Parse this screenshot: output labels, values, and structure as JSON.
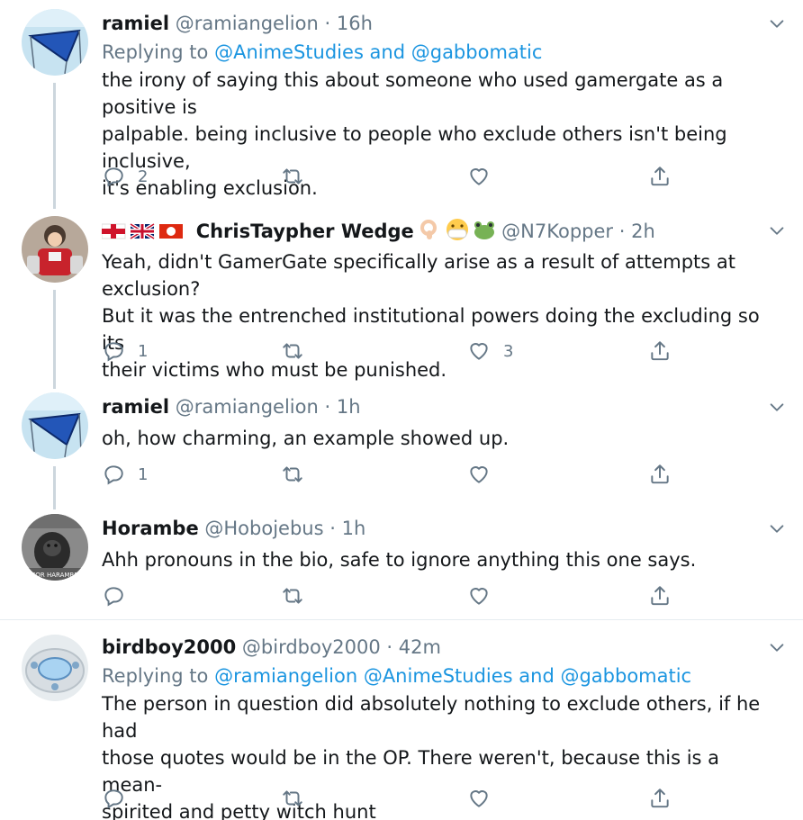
{
  "tweets": [
    {
      "name": "ramiel",
      "handle": "@ramiangelion",
      "sep": "·",
      "time": "16h",
      "replying_prefix": "Replying to",
      "replying_mentions": "@AnimeStudies and @gabbomatic",
      "lines": [
        "the irony of saying this about someone who used gamergate as a positive is",
        "palpable. being inclusive to people who exclude others isn't being inclusive,",
        "it's enabling exclusion."
      ],
      "replies": "2",
      "retweets": "",
      "likes": ""
    },
    {
      "name": "ChrisTaypher Wedge",
      "handle": "@N7Kopper",
      "sep": "·",
      "time": "2h",
      "lines": [
        "Yeah, didn't GamerGate specifically arise as a result of attempts at exclusion?",
        "But it was the entrenched institutional powers doing the excluding so its",
        "their victims who must be punished."
      ],
      "replies": "1",
      "retweets": "",
      "likes": "3"
    },
    {
      "name": "ramiel",
      "handle": "@ramiangelion",
      "sep": "·",
      "time": "1h",
      "lines": [
        "oh, how charming, an example showed up."
      ],
      "replies": "1",
      "retweets": "",
      "likes": ""
    },
    {
      "name": "Horambe",
      "handle": "@Hobojebus",
      "sep": "·",
      "time": "1h",
      "lines": [
        "Ahh pronouns in the bio, safe to ignore anything this one says."
      ],
      "replies": "",
      "retweets": "",
      "likes": ""
    },
    {
      "name": "birdboy2000",
      "handle": "@birdboy2000",
      "sep": "·",
      "time": "42m",
      "replying_prefix": "Replying to",
      "replying_mentions": "@ramiangelion @AnimeStudies and @gabbomatic",
      "lines": [
        "The person in question did absolutely nothing to exclude others, if he had",
        "those quotes would be in the OP. There weren't, because this is a mean-",
        "spirited and petty witch hunt"
      ],
      "replies": "",
      "retweets": "",
      "likes": ""
    }
  ],
  "avatar_text": "FOR HARAMBE",
  "icons": [
    "reply-icon",
    "retweet-icon",
    "like-icon",
    "share-icon",
    "chevron-down-icon"
  ],
  "colors": {
    "text": "#14171a",
    "muted": "#657786",
    "link": "#1b95e0",
    "line": "#ccd6dd"
  }
}
